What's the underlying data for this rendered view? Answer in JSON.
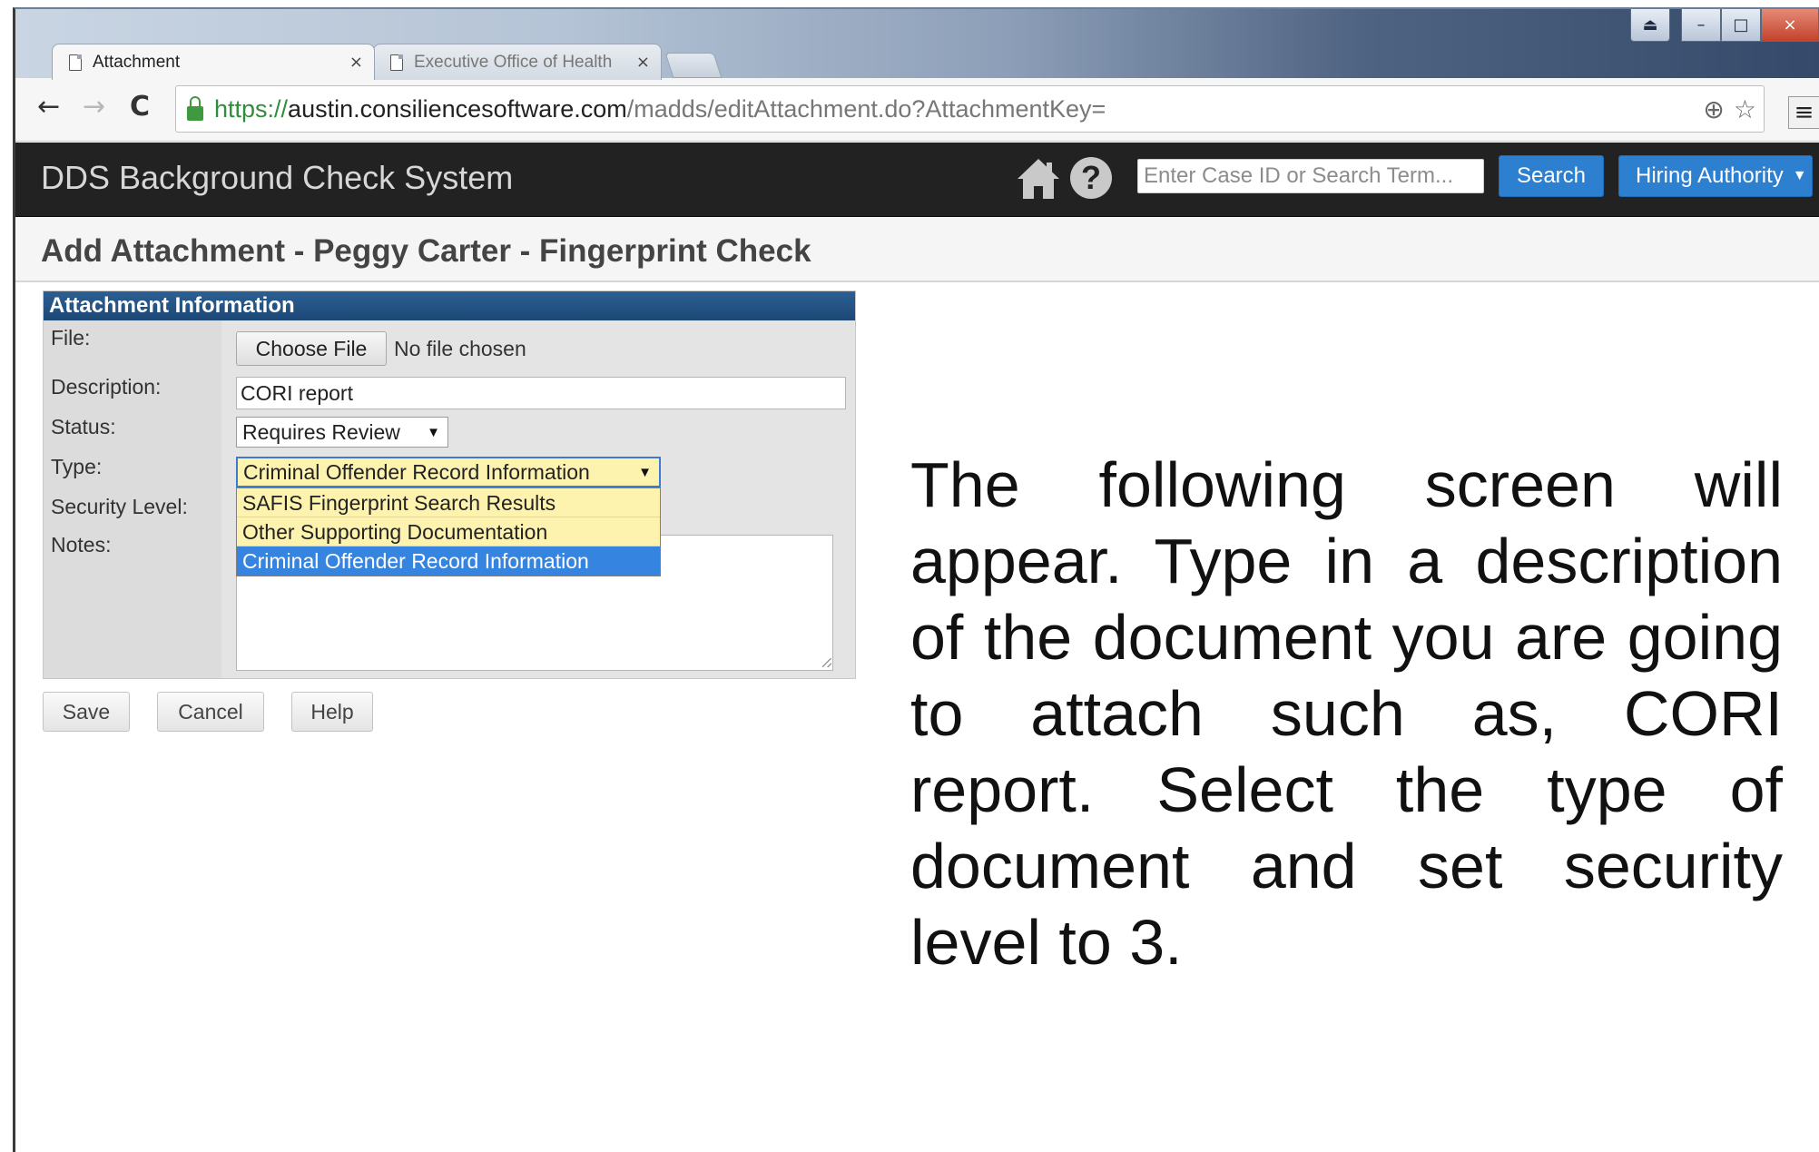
{
  "browser": {
    "tabs": [
      {
        "title": "Attachment"
      },
      {
        "title": "Executive Office of Health"
      }
    ],
    "url": {
      "scheme": "https://",
      "host": "austin.consiliencesoftware.com",
      "path": "/madds/editAttachment.do?AttachmentKey="
    },
    "icons": {
      "back": "←",
      "forward": "→",
      "reload": "C",
      "zoom": "⊕",
      "star": "☆",
      "menu": "≡",
      "close": "×",
      "minimize": "–",
      "maximize": "□",
      "user": "⏏"
    }
  },
  "header": {
    "app_title": "DDS Background Check System",
    "search_placeholder": "Enter Case ID or Search Term...",
    "search_label": "Search",
    "hiring_label": "Hiring Authority",
    "help_glyph": "?"
  },
  "page": {
    "title": "Add Attachment - Peggy Carter - Fingerprint Check"
  },
  "form": {
    "panel_title": "Attachment Information",
    "labels": {
      "file": "File:",
      "description": "Description:",
      "status": "Status:",
      "type": "Type:",
      "security": "Security Level:",
      "notes": "Notes:"
    },
    "file_button": "Choose File",
    "file_status": "No file chosen",
    "description_value": "CORI report",
    "status_value": "Requires Review",
    "type_value": "Criminal Offender Record Information",
    "type_options": [
      "SAFIS Fingerprint Search Results",
      "Other Supporting Documentation",
      "Criminal Offender Record Information"
    ],
    "buttons": {
      "save": "Save",
      "cancel": "Cancel",
      "help": "Help"
    }
  },
  "instruction_text": "The following screen will appear.  Type in a description of the document you are going to attach such as, CORI report. Select the type of document and set security level to 3.",
  "colors": {
    "app_bar": "#222222",
    "accent_blue": "#2d7fd0",
    "panel_header": "#1d4876",
    "selected_option": "#3584e0",
    "dropdown_bg": "#fdf3ae"
  }
}
